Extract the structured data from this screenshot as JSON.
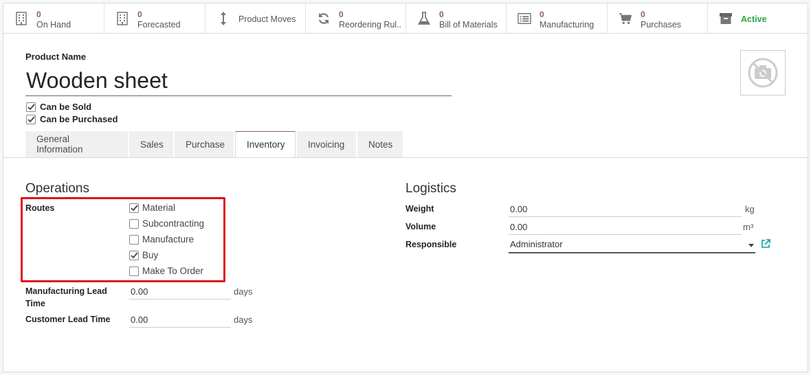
{
  "smart_buttons": [
    {
      "icon": "building-icon",
      "count": "0",
      "label": "On Hand"
    },
    {
      "icon": "building-icon",
      "count": "0",
      "label": "Forecasted"
    },
    {
      "icon": "arrows-vertical-icon",
      "count": "",
      "label": "Product Moves"
    },
    {
      "icon": "refresh-icon",
      "count": "0",
      "label": "Reordering Rul..."
    },
    {
      "icon": "flask-icon",
      "count": "0",
      "label": "Bill of Materials"
    },
    {
      "icon": "list-alt-icon",
      "count": "0",
      "label": "Manufacturing"
    },
    {
      "icon": "shopping-cart-icon",
      "count": "0",
      "label": "Purchases"
    },
    {
      "icon": "archive-icon",
      "count": "",
      "label": "Active"
    }
  ],
  "product": {
    "name_label": "Product Name",
    "name": "Wooden sheet",
    "can_be_sold_label": "Can be Sold",
    "can_be_sold": true,
    "can_be_purchased_label": "Can be Purchased",
    "can_be_purchased": true
  },
  "tabs": [
    {
      "label": "General Information",
      "active": false
    },
    {
      "label": "Sales",
      "active": false
    },
    {
      "label": "Purchase",
      "active": false
    },
    {
      "label": "Inventory",
      "active": true
    },
    {
      "label": "Invoicing",
      "active": false
    },
    {
      "label": "Notes",
      "active": false
    }
  ],
  "operations": {
    "title": "Operations",
    "routes_label": "Routes",
    "routes": [
      {
        "label": "Material",
        "checked": true
      },
      {
        "label": "Subcontracting",
        "checked": false
      },
      {
        "label": "Manufacture",
        "checked": false
      },
      {
        "label": "Buy",
        "checked": true
      },
      {
        "label": "Make To Order",
        "checked": false
      }
    ],
    "mfg_lead_label": "Manufacturing Lead Time",
    "mfg_lead_value": "0.00",
    "mfg_lead_unit": "days",
    "customer_lead_label": "Customer Lead Time",
    "customer_lead_value": "0.00",
    "customer_lead_unit": "days"
  },
  "logistics": {
    "title": "Logistics",
    "weight_label": "Weight",
    "weight_value": "0.00",
    "weight_unit": "kg",
    "volume_label": "Volume",
    "volume_value": "0.00",
    "volume_unit": "m³",
    "responsible_label": "Responsible",
    "responsible_value": "Administrator"
  },
  "colors": {
    "brand": "#875a7b",
    "active": "#28a745",
    "highlight": "#e0101a",
    "link": "#00a09d"
  }
}
